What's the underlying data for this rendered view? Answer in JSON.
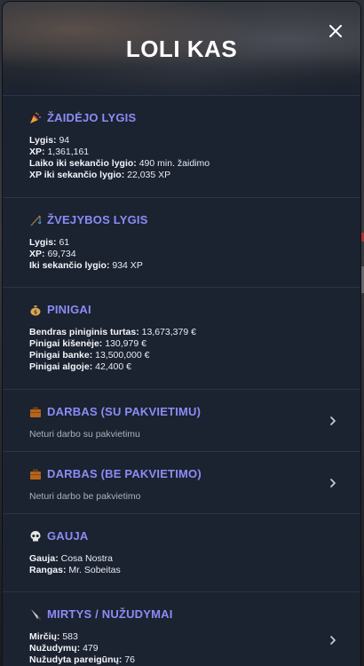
{
  "title": "LOLI KAS",
  "sections": {
    "player": {
      "heading": "ŽAIDĖJO LYGIS",
      "icon": "party-popper-icon",
      "rows": [
        {
          "label": "Lygis",
          "value": "94"
        },
        {
          "label": "XP",
          "value": "1,361,161"
        },
        {
          "label": "Laiko iki sekančio lygio",
          "value": "490 min. žaidimo"
        },
        {
          "label": "XP iki sekančio lygio",
          "value": "22,035 XP"
        }
      ]
    },
    "fishing": {
      "heading": "ŽVEJYBOS LYGIS",
      "icon": "fishing-pole-icon",
      "rows": [
        {
          "label": "Lygis",
          "value": "61"
        },
        {
          "label": "XP",
          "value": "69,734"
        },
        {
          "label": "Iki sekančio lygio",
          "value": "934 XP"
        }
      ]
    },
    "money": {
      "heading": "PINIGAI",
      "icon": "money-bag-icon",
      "rows": [
        {
          "label": "Bendras piniginis turtas",
          "value": "13,673,379 €"
        },
        {
          "label": "Pinigai kišenėje",
          "value": "130,979 €"
        },
        {
          "label": "Pinigai banke",
          "value": "13,500,000 €"
        },
        {
          "label": "Pinigai algoje",
          "value": "42,400 €"
        }
      ]
    },
    "job_invite": {
      "heading": "DARBAS (SU PAKVIETIMU)",
      "icon": "briefcase-icon",
      "text": "Neturi darbo su pakvietimu"
    },
    "job_noinvite": {
      "heading": "DARBAS (BE PAKVIETIMO)",
      "icon": "briefcase-icon",
      "text": "Neturi darbo be pakvietimo"
    },
    "gang": {
      "heading": "GAUJA",
      "icon": "skull-icon",
      "rows": [
        {
          "label": "Gauja",
          "value": "Cosa Nostra"
        },
        {
          "label": "Rangas",
          "value": "Mr. Sobeitas"
        }
      ]
    },
    "deaths": {
      "heading": "MIRTYS / NUŽUDYMAI",
      "icon": "knife-icon",
      "rows": [
        {
          "label": "Mirčių",
          "value": "583"
        },
        {
          "label": "Nužudymų",
          "value": "479"
        },
        {
          "label": "Nužudyta pareigūnų",
          "value": "76"
        }
      ]
    }
  },
  "colors": {
    "accent": "#8b8cf5",
    "panel": "#1b2230",
    "divider": "#2c3445"
  }
}
